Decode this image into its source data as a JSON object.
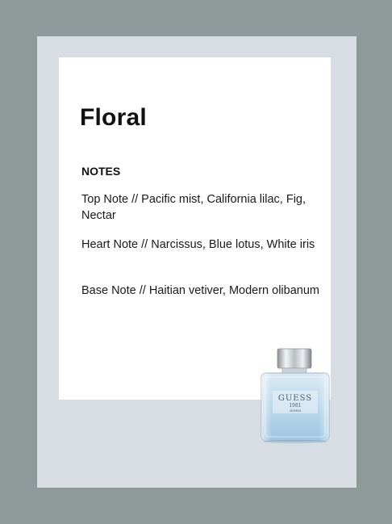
{
  "title": "Floral",
  "notes": {
    "heading": "NOTES",
    "top": "Top Note // Pacific mist, California lilac, Fig, Nectar",
    "heart": "Heart Note // Narcissus, Blue lotus, White iris",
    "base": "Base Note // Haitian vetiver, Modern olibanum"
  },
  "bottle": {
    "brand": "GUESS",
    "year": "1981",
    "subtitle": "WOMEN"
  },
  "colors": {
    "background": "#8e9a9a",
    "frame": "#d7dde2",
    "card": "#ffffff",
    "liquid": "#bcd9ea"
  }
}
